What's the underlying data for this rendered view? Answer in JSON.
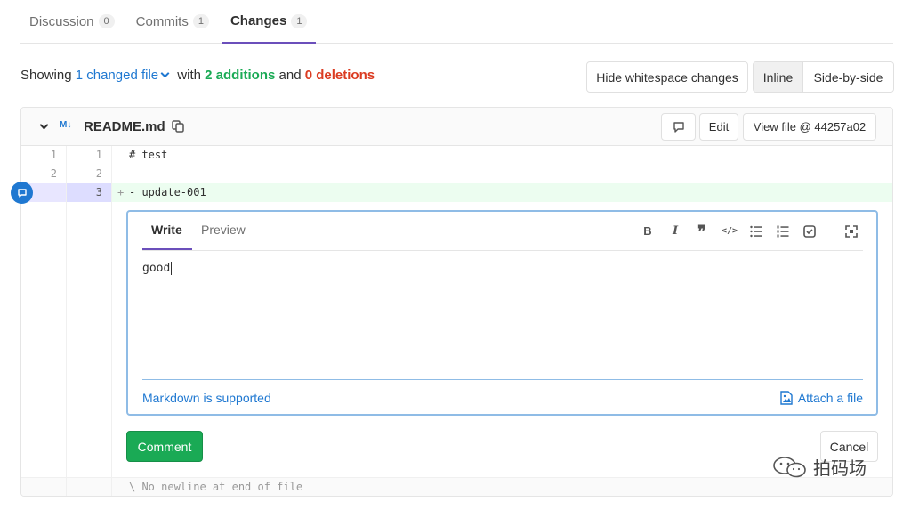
{
  "tabs": [
    {
      "label": "Discussion",
      "count": "0"
    },
    {
      "label": "Commits",
      "count": "1"
    },
    {
      "label": "Changes",
      "count": "1"
    }
  ],
  "summary": {
    "prefix": "Showing",
    "files": "1 changed file",
    "with": "with",
    "additions": "2 additions",
    "and": "and",
    "deletions": "0 deletions"
  },
  "toolbar": {
    "hide_whitespace": "Hide whitespace changes",
    "inline": "Inline",
    "side_by_side": "Side-by-side"
  },
  "file": {
    "icon_label": "M↓",
    "name": "README.md",
    "edit": "Edit",
    "view_file": "View file @ 44257a02"
  },
  "lines": [
    {
      "old": "1",
      "new": "1",
      "text": "# test"
    },
    {
      "old": "2",
      "new": "2",
      "text": ""
    },
    {
      "old": "",
      "new": "3",
      "text": "- update-001",
      "sign": "+"
    }
  ],
  "editor": {
    "write_tab": "Write",
    "preview_tab": "Preview",
    "content": "good",
    "markdown_note": "Markdown is supported",
    "attach": "Attach a file"
  },
  "actions": {
    "comment": "Comment",
    "cancel": "Cancel"
  },
  "no_newline": "\\ No newline at end of file",
  "watermark": "拍码场",
  "colors": {
    "accent": "#6b4fbb",
    "link": "#1f78d1",
    "added": "#1aaa55",
    "deleted": "#db3b21"
  }
}
